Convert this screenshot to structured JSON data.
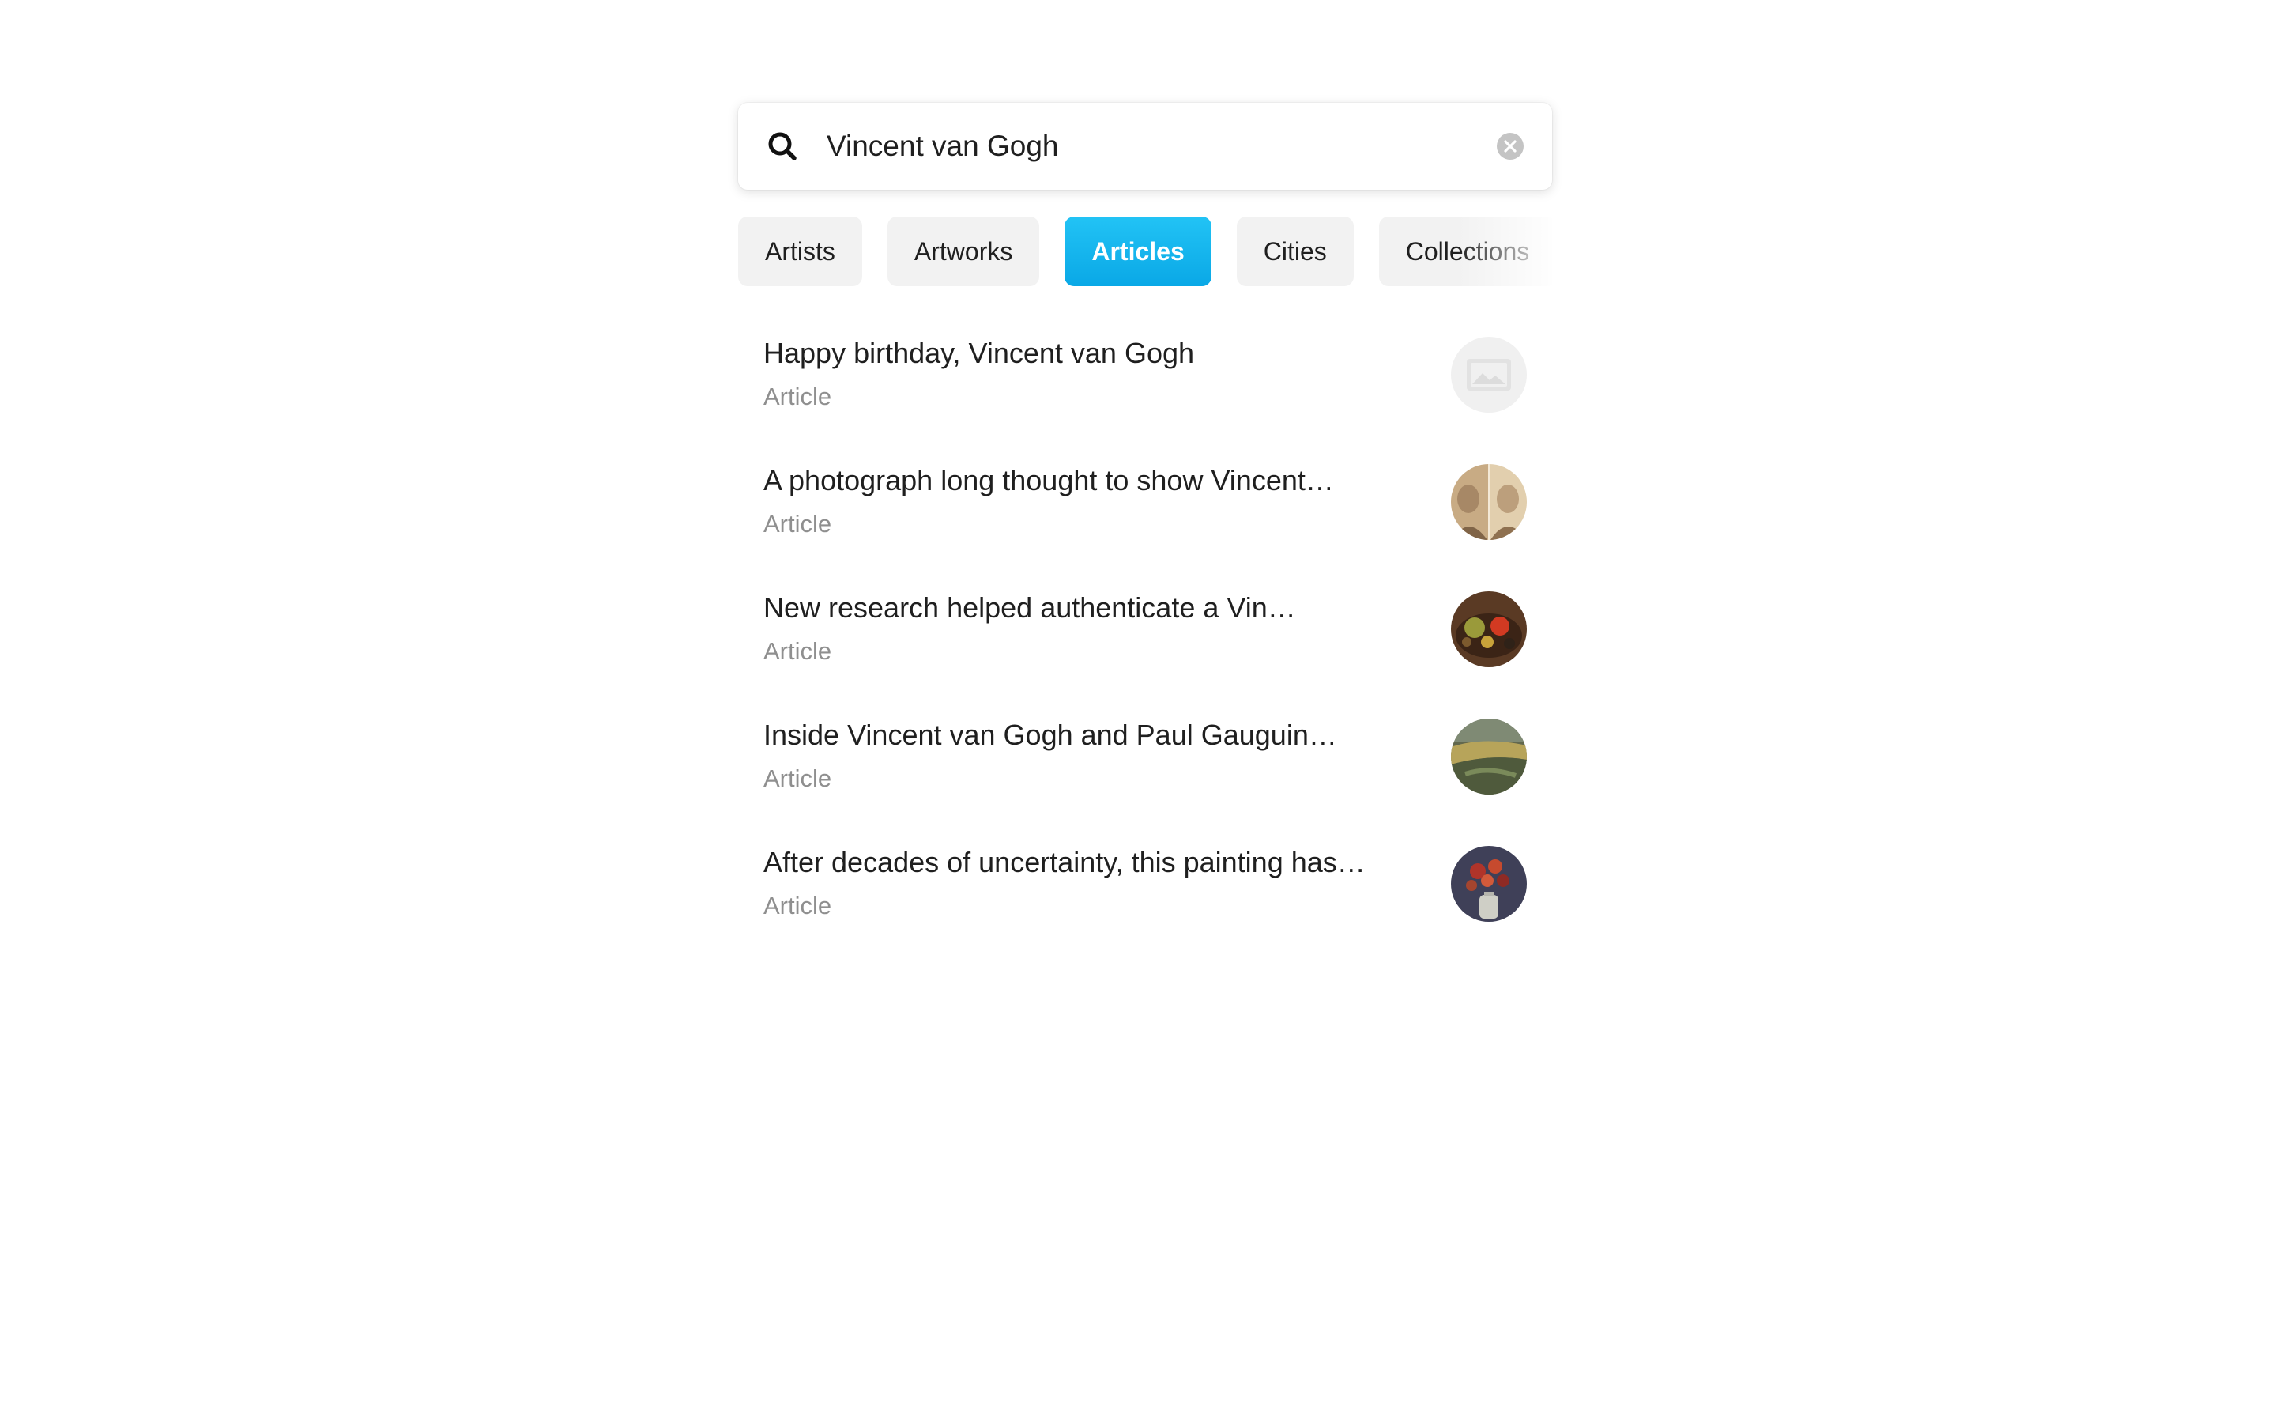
{
  "search": {
    "value": "Vincent van Gogh",
    "icon": "search-icon",
    "clear_icon": "clear-icon"
  },
  "tabs": [
    {
      "label": "Artists",
      "active": false
    },
    {
      "label": "Artworks",
      "active": false
    },
    {
      "label": "Articles",
      "active": true
    },
    {
      "label": "Cities",
      "active": false
    },
    {
      "label": "Collections",
      "active": false
    }
  ],
  "colors": {
    "accent": "#13b5ee",
    "tab_background": "#f2f2f2",
    "text_primary": "#1f1f1f",
    "text_secondary": "#8f8f8f"
  },
  "results": [
    {
      "title": "Happy birthday, Vincent van Gogh",
      "type": "Article",
      "thumbnail": "image-placeholder-icon"
    },
    {
      "title": "A photograph long thought to show Vincent…",
      "type": "Article",
      "thumbnail": "sepia-portraits-thumbnail"
    },
    {
      "title": "New research helped authenticate a Vin…",
      "type": "Article",
      "thumbnail": "still-life-thumbnail"
    },
    {
      "title": "Inside Vincent van Gogh and Paul Gauguin…",
      "type": "Article",
      "thumbnail": "landscape-thumbnail"
    },
    {
      "title": "After decades of uncertainty, this painting has…",
      "type": "Article",
      "thumbnail": "flower-vase-thumbnail"
    }
  ]
}
